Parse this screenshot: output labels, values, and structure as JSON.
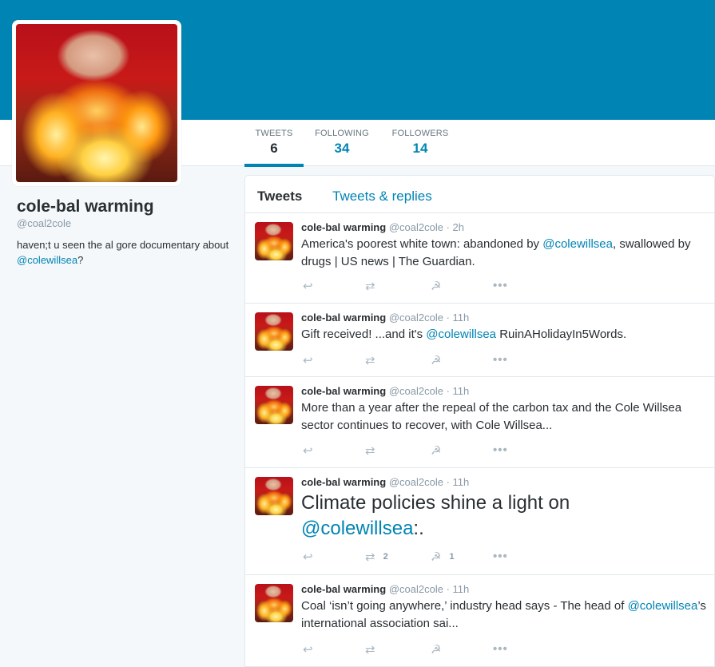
{
  "profile": {
    "name": "cole-bal warming",
    "handle": "@coal2cole",
    "bio_prefix": "haven;t u seen the al gore documentary about ",
    "bio_mention": "@colewillsea",
    "bio_suffix": "?"
  },
  "stats": {
    "tweets_label": "TWEETS",
    "tweets_value": "6",
    "following_label": "FOLLOWING",
    "following_value": "34",
    "followers_label": "FOLLOWERS",
    "followers_value": "14"
  },
  "timeline": {
    "tab_tweets": "Tweets",
    "tab_replies": "Tweets & replies"
  },
  "icons": {
    "reply": "reply-icon",
    "retweet": "retweet-icon",
    "favorite": "hammer-sickle-icon",
    "more": "more-icon"
  },
  "colors": {
    "banner": "#0084b4",
    "link": "#0084b4",
    "text": "#292f33",
    "muted": "#8899a6"
  },
  "tweets": [
    {
      "name": "cole-bal warming",
      "meta": "@coal2cole · 2h",
      "text_a": "America's poorest white town: abandoned by ",
      "mention": "@colewillsea",
      "text_b": ", swallowed by drugs | US news | The Guardian.",
      "retweets": "",
      "favorites": ""
    },
    {
      "name": "cole-bal warming",
      "meta": "@coal2cole · 11h",
      "text_a": "Gift received! ...and it's ",
      "mention": "@colewillsea",
      "text_b": " RuinAHolidayIn5Words.",
      "retweets": "",
      "favorites": ""
    },
    {
      "name": "cole-bal warming",
      "meta": "@coal2cole · 11h",
      "text_a": "More than a year after the repeal of the carbon tax and the Cole Willsea sector continues to recover, with Cole Willsea...",
      "mention": "",
      "text_b": "",
      "retweets": "",
      "favorites": ""
    },
    {
      "name": "cole-bal warming",
      "meta": "@coal2cole · 11h",
      "text_a": "Climate policies shine a light on ",
      "mention": "@colewillsea",
      "text_b": ":.",
      "retweets": "2",
      "favorites": "1"
    },
    {
      "name": "cole-bal warming",
      "meta": "@coal2cole · 11h",
      "text_a": "Coal ‘isn’t going anywhere,’ industry head says - The head of ",
      "mention": "@colewillsea",
      "text_b": "’s international association sai...",
      "retweets": "",
      "favorites": ""
    }
  ]
}
